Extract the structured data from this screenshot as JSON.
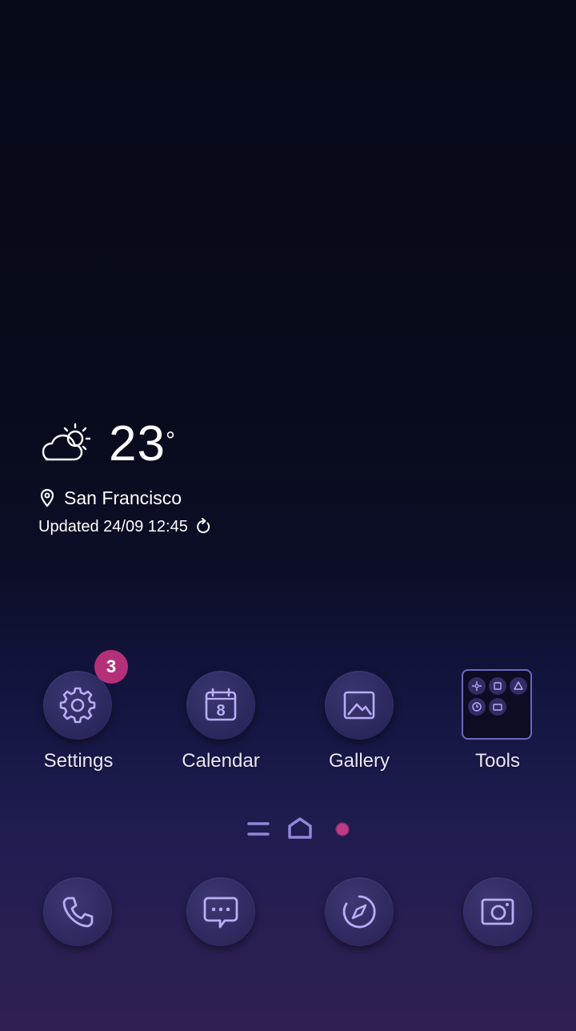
{
  "weather": {
    "temperature": "23",
    "degree_symbol": "°",
    "location": "San Francisco",
    "updated": "Updated 24/09 12:45",
    "condition_icon": "partly-cloudy-icon"
  },
  "apps": [
    {
      "label": "Settings",
      "icon": "gear-icon",
      "badge": "3"
    },
    {
      "label": "Calendar",
      "icon": "calendar-icon",
      "date": "8"
    },
    {
      "label": "Gallery",
      "icon": "image-icon"
    },
    {
      "label": "Tools",
      "icon": "folder-icon"
    }
  ],
  "dock": [
    {
      "icon": "phone-icon"
    },
    {
      "icon": "message-icon"
    },
    {
      "icon": "compass-icon"
    },
    {
      "icon": "camera-icon"
    }
  ],
  "colors": {
    "icon_stroke": "#b7aef5",
    "badge": "#b4317a",
    "current_page_dot": "#c23a86"
  }
}
